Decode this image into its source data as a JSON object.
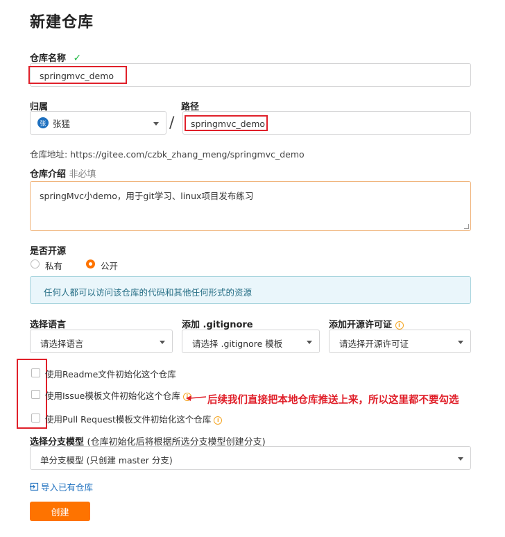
{
  "page": {
    "title": "新建仓库"
  },
  "repo_name": {
    "label": "仓库名称",
    "value": "springmvc_demo"
  },
  "owner": {
    "label": "归属",
    "avatar_text": "张",
    "value": "张猛"
  },
  "path": {
    "label": "路径",
    "separator": "/",
    "value": "springmvc_demo"
  },
  "repo_address": {
    "text": "仓库地址: https://gitee.com/czbk_zhang_meng/springmvc_demo"
  },
  "intro": {
    "label": "仓库介绍",
    "optional": "非必填",
    "value": "springMvc小demo，用于git学习、linux项目发布练习"
  },
  "open_source": {
    "label": "是否开源",
    "options": [
      {
        "label": "私有",
        "selected": false
      },
      {
        "label": "公开",
        "selected": true
      }
    ],
    "notice": "任何人都可以访问该仓库的代码和其他任何形式的资源"
  },
  "language": {
    "label": "选择语言",
    "placeholder": "请选择语言"
  },
  "gitignore": {
    "label": "添加 .gitignore",
    "placeholder": "请选择 .gitignore 模板"
  },
  "license": {
    "label": "添加开源许可证",
    "placeholder": "请选择开源许可证"
  },
  "init_options": [
    {
      "label": "使用Readme文件初始化这个仓库",
      "info": false
    },
    {
      "label": "使用Issue模板文件初始化这个仓库",
      "info": true
    },
    {
      "label": "使用Pull Request模板文件初始化这个仓库",
      "info": true
    }
  ],
  "branch_model": {
    "label": "选择分支模型",
    "hint": "(仓库初始化后将根据所选分支模型创建分支)",
    "value": "单分支模型 (只创建 master 分支)"
  },
  "import_link": "导入已有仓库",
  "create_button": "创建",
  "annotation": "后续我们直接把本地仓库推送上来，所以这里都不要勾选",
  "colors": {
    "accent": "#fe7300",
    "success": "#21ba45",
    "annotation_red": "#e0202a",
    "notice_bg": "#eaf6fb"
  }
}
